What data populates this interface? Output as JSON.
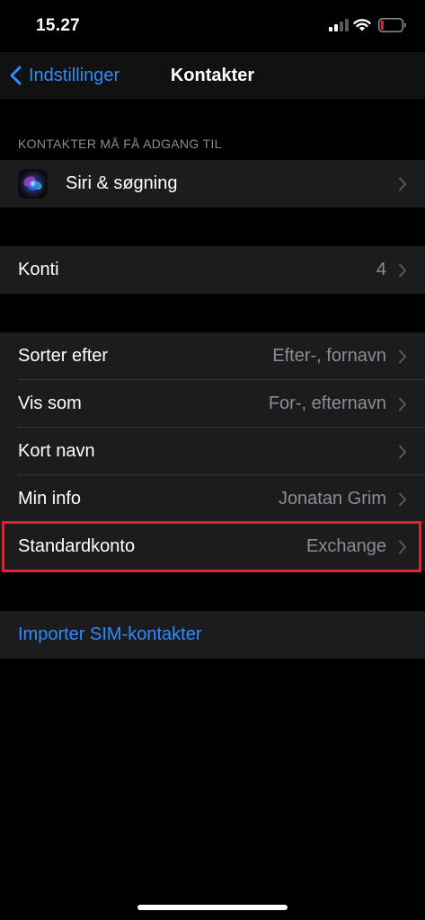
{
  "status_bar": {
    "time": "15.27",
    "icons": [
      "signal-icon",
      "wifi-icon",
      "battery-icon"
    ]
  },
  "nav": {
    "back_label": "Indstillinger",
    "title": "Kontakter"
  },
  "access_section": {
    "header": "KONTAKTER MÅ FÅ ADGANG TIL",
    "siri": {
      "label": "Siri & søgning",
      "icon": "siri-icon"
    }
  },
  "accounts": {
    "label": "Konti",
    "value": "4"
  },
  "settings": {
    "items": [
      {
        "label": "Sorter efter",
        "value": "Efter-, fornavn"
      },
      {
        "label": "Vis som",
        "value": "For-, efternavn"
      },
      {
        "label": "Kort navn",
        "value": ""
      },
      {
        "label": "Min info",
        "value": "Jonatan Grim"
      },
      {
        "label": "Standardkonto",
        "value": "Exchange"
      }
    ]
  },
  "import": {
    "label": "Importer SIM-kontakter"
  },
  "colors": {
    "background": "#000000",
    "cell": "#1c1c1e",
    "accent": "#2f8cff",
    "secondary_text": "#8d8d93",
    "highlight": "#e0232e",
    "battery_low": "#e0232e"
  }
}
